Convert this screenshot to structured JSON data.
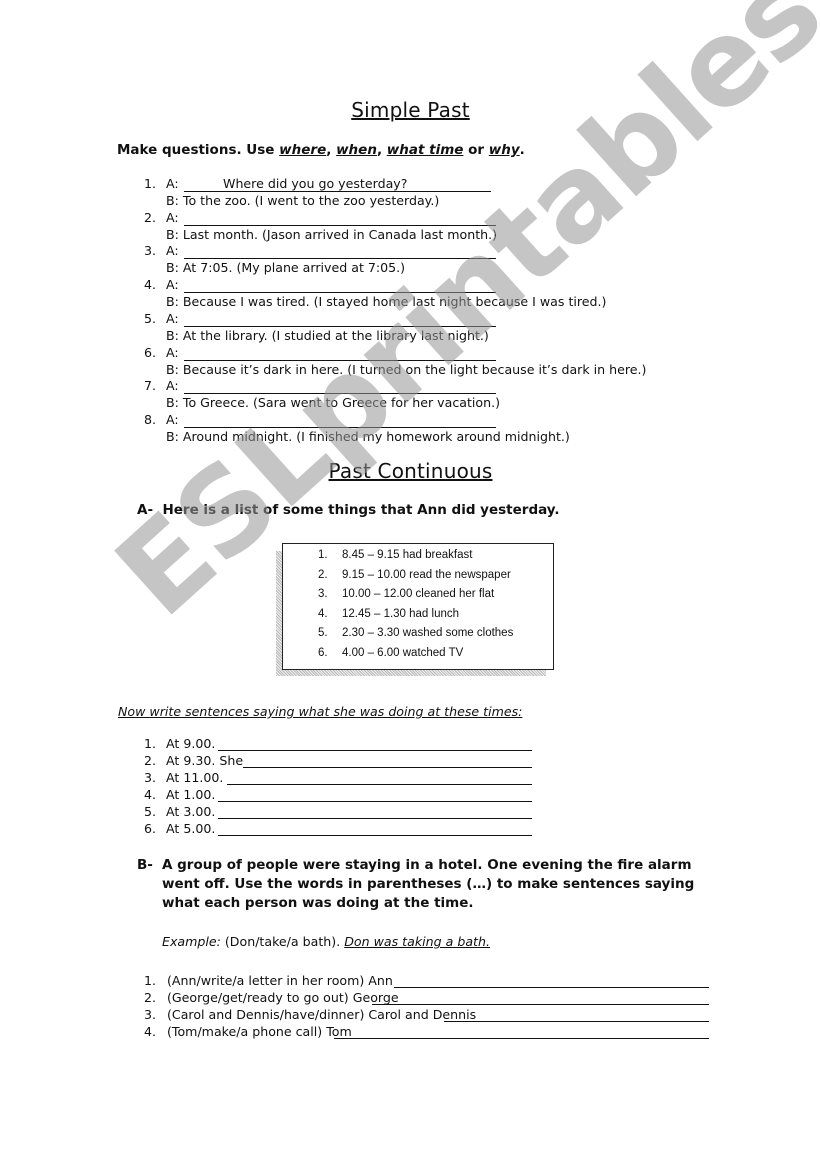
{
  "simple_past": {
    "title": "Simple Past",
    "instruction_prefix": "Make questions. Use ",
    "keywords": [
      "where",
      "when",
      "what time",
      "why"
    ],
    "sep1": ", ",
    "sep2": ", ",
    "sep3": " or ",
    "end": ".",
    "items": [
      {
        "num": "1.",
        "a_label": "A:",
        "a_answer": "Where did you go yesterday?",
        "b": "B: To the zoo. (I went to the zoo yesterday.)"
      },
      {
        "num": "2.",
        "a_label": "A:",
        "a_answer": "",
        "b": "B: Last month. (Jason arrived in Canada last month.)"
      },
      {
        "num": "3.",
        "a_label": "A:",
        "a_answer": "",
        "b": "B: At 7:05. (My plane arrived at 7:05.)"
      },
      {
        "num": "4.",
        "a_label": "A:",
        "a_answer": "",
        "b": "B: Because I was tired.  (I stayed home last night because I was tired.)"
      },
      {
        "num": "5.",
        "a_label": "A:",
        "a_answer": "",
        "b": "B: At the library. (I studied at the library last night.)"
      },
      {
        "num": "6.",
        "a_label": "A:",
        "a_answer": "",
        "b": "B: Because it’s dark  in here. (I turned on the light because it’s dark in here.)"
      },
      {
        "num": "7.",
        "a_label": "A:",
        "a_answer": "",
        "b": "B: To Greece. (Sara went to Greece for her vacation.)"
      },
      {
        "num": "8.",
        "a_label": "A:",
        "a_answer": "",
        "b": "B: Around midnight. (I finished my homework around midnight.)"
      }
    ]
  },
  "past_continuous": {
    "title": "Past Continuous",
    "part_a": {
      "label": "A-",
      "instruction": "Here is a list of some things that Ann did yesterday.",
      "schedule": [
        {
          "num": "1.",
          "text": "8.45 – 9.15 had breakfast"
        },
        {
          "num": "2.",
          "text": "9.15 – 10.00 read the newspaper"
        },
        {
          "num": "3.",
          "text": "10.00 – 12.00 cleaned her flat"
        },
        {
          "num": "4.",
          "text": "12.45 – 1.30 had lunch"
        },
        {
          "num": "5.",
          "text": "2.30 – 3.30 washed some clothes"
        },
        {
          "num": "6.",
          "text": "4.00 – 6.00 watched TV"
        }
      ],
      "sub_instruction": "Now write sentences saying what she was doing at these times:",
      "exercises": [
        {
          "num": "1.",
          "prompt": "At 9.00."
        },
        {
          "num": "2.",
          "prompt": "At 9.30. She"
        },
        {
          "num": "3.",
          "prompt": "At 11.00."
        },
        {
          "num": "4.",
          "prompt": "At 1.00."
        },
        {
          "num": "5.",
          "prompt": "At 3.00."
        },
        {
          "num": "6.",
          "prompt": "At 5.00."
        }
      ]
    },
    "part_b": {
      "label": "B-",
      "instruction": "A group of people were staying in a hotel. One evening the fire alarm went off. Use the words in parentheses (…) to make sentences saying what each person was doing at the time.",
      "example_label": "Example:",
      "example_prompt": " (Don/take/a bath). ",
      "example_answer": "Don was taking a bath.",
      "exercises": [
        {
          "num": "1.",
          "prompt": "(Ann/write/a letter in her room) Ann"
        },
        {
          "num": "2.",
          "prompt": "(George/get/ready to go out) George"
        },
        {
          "num": "3.",
          "prompt": "(Carol and Dennis/have/dinner) Carol and Dennis"
        },
        {
          "num": "4.",
          "prompt": "(Tom/make/a phone call) Tom"
        }
      ]
    }
  },
  "watermark": "ESLprintables.com"
}
